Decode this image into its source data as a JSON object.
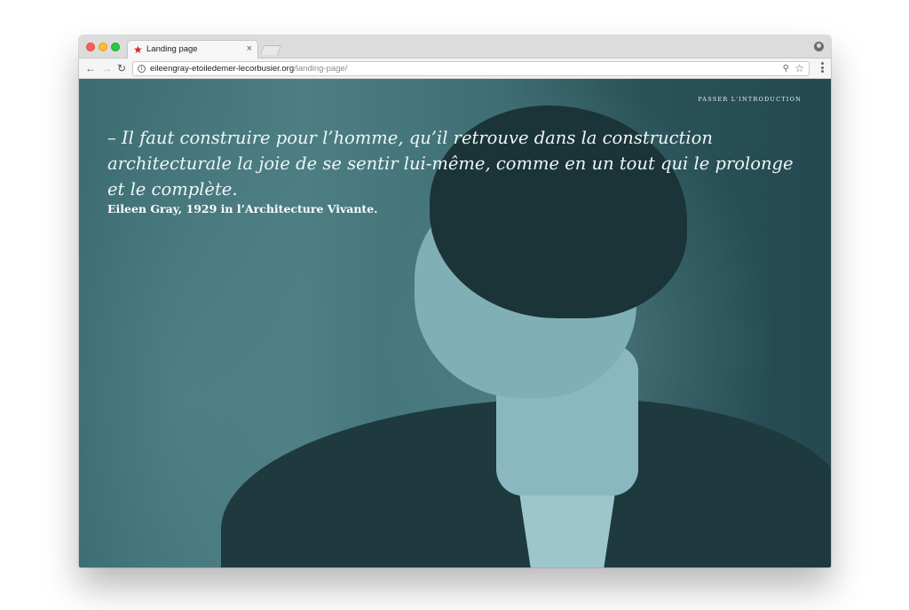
{
  "browser": {
    "tab": {
      "title": "Landing page",
      "favicon": "red-star-icon",
      "close": "×"
    },
    "url": {
      "host": "eileengray-etoiledemer-lecorbusier.org",
      "path": "/landing-page/"
    },
    "icons": {
      "back": "←",
      "forward": "→",
      "reload": "↻",
      "info": "i",
      "zoom": "⚲",
      "bookmark": "☆"
    }
  },
  "page": {
    "skip_link": "PASSER L'INTRODUCTION",
    "quote": "– Il faut construire pour l’homme, qu’il retrouve dans la construction architecturale la joie de se sentir lui-même, comme en un tout qui le prolonge et le complète.",
    "attribution": "Eileen Gray, 1929 in l’Architecture Vivante.",
    "colors": {
      "overlay": "#3c6c72",
      "text": "#eef6f7",
      "favicon": "#d2232a"
    }
  }
}
